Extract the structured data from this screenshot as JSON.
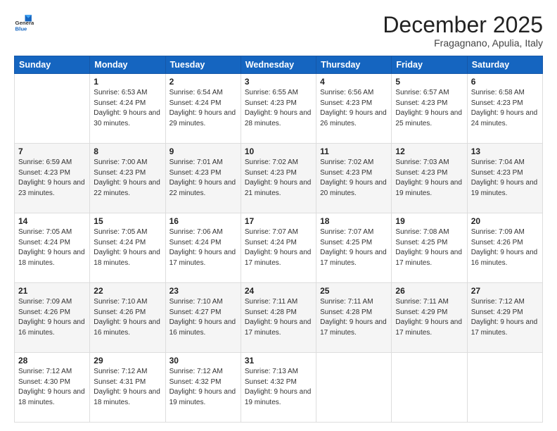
{
  "header": {
    "logo_general": "General",
    "logo_blue": "Blue",
    "month_title": "December 2025",
    "subtitle": "Fragagnano, Apulia, Italy"
  },
  "days_of_week": [
    "Sunday",
    "Monday",
    "Tuesday",
    "Wednesday",
    "Thursday",
    "Friday",
    "Saturday"
  ],
  "weeks": [
    [
      {
        "day": "",
        "sunrise": "",
        "sunset": "",
        "daylight": ""
      },
      {
        "day": "1",
        "sunrise": "Sunrise: 6:53 AM",
        "sunset": "Sunset: 4:24 PM",
        "daylight": "Daylight: 9 hours and 30 minutes."
      },
      {
        "day": "2",
        "sunrise": "Sunrise: 6:54 AM",
        "sunset": "Sunset: 4:24 PM",
        "daylight": "Daylight: 9 hours and 29 minutes."
      },
      {
        "day": "3",
        "sunrise": "Sunrise: 6:55 AM",
        "sunset": "Sunset: 4:23 PM",
        "daylight": "Daylight: 9 hours and 28 minutes."
      },
      {
        "day": "4",
        "sunrise": "Sunrise: 6:56 AM",
        "sunset": "Sunset: 4:23 PM",
        "daylight": "Daylight: 9 hours and 26 minutes."
      },
      {
        "day": "5",
        "sunrise": "Sunrise: 6:57 AM",
        "sunset": "Sunset: 4:23 PM",
        "daylight": "Daylight: 9 hours and 25 minutes."
      },
      {
        "day": "6",
        "sunrise": "Sunrise: 6:58 AM",
        "sunset": "Sunset: 4:23 PM",
        "daylight": "Daylight: 9 hours and 24 minutes."
      }
    ],
    [
      {
        "day": "7",
        "sunrise": "Sunrise: 6:59 AM",
        "sunset": "Sunset: 4:23 PM",
        "daylight": "Daylight: 9 hours and 23 minutes."
      },
      {
        "day": "8",
        "sunrise": "Sunrise: 7:00 AM",
        "sunset": "Sunset: 4:23 PM",
        "daylight": "Daylight: 9 hours and 22 minutes."
      },
      {
        "day": "9",
        "sunrise": "Sunrise: 7:01 AM",
        "sunset": "Sunset: 4:23 PM",
        "daylight": "Daylight: 9 hours and 22 minutes."
      },
      {
        "day": "10",
        "sunrise": "Sunrise: 7:02 AM",
        "sunset": "Sunset: 4:23 PM",
        "daylight": "Daylight: 9 hours and 21 minutes."
      },
      {
        "day": "11",
        "sunrise": "Sunrise: 7:02 AM",
        "sunset": "Sunset: 4:23 PM",
        "daylight": "Daylight: 9 hours and 20 minutes."
      },
      {
        "day": "12",
        "sunrise": "Sunrise: 7:03 AM",
        "sunset": "Sunset: 4:23 PM",
        "daylight": "Daylight: 9 hours and 19 minutes."
      },
      {
        "day": "13",
        "sunrise": "Sunrise: 7:04 AM",
        "sunset": "Sunset: 4:23 PM",
        "daylight": "Daylight: 9 hours and 19 minutes."
      }
    ],
    [
      {
        "day": "14",
        "sunrise": "Sunrise: 7:05 AM",
        "sunset": "Sunset: 4:24 PM",
        "daylight": "Daylight: 9 hours and 18 minutes."
      },
      {
        "day": "15",
        "sunrise": "Sunrise: 7:05 AM",
        "sunset": "Sunset: 4:24 PM",
        "daylight": "Daylight: 9 hours and 18 minutes."
      },
      {
        "day": "16",
        "sunrise": "Sunrise: 7:06 AM",
        "sunset": "Sunset: 4:24 PM",
        "daylight": "Daylight: 9 hours and 17 minutes."
      },
      {
        "day": "17",
        "sunrise": "Sunrise: 7:07 AM",
        "sunset": "Sunset: 4:24 PM",
        "daylight": "Daylight: 9 hours and 17 minutes."
      },
      {
        "day": "18",
        "sunrise": "Sunrise: 7:07 AM",
        "sunset": "Sunset: 4:25 PM",
        "daylight": "Daylight: 9 hours and 17 minutes."
      },
      {
        "day": "19",
        "sunrise": "Sunrise: 7:08 AM",
        "sunset": "Sunset: 4:25 PM",
        "daylight": "Daylight: 9 hours and 17 minutes."
      },
      {
        "day": "20",
        "sunrise": "Sunrise: 7:09 AM",
        "sunset": "Sunset: 4:26 PM",
        "daylight": "Daylight: 9 hours and 16 minutes."
      }
    ],
    [
      {
        "day": "21",
        "sunrise": "Sunrise: 7:09 AM",
        "sunset": "Sunset: 4:26 PM",
        "daylight": "Daylight: 9 hours and 16 minutes."
      },
      {
        "day": "22",
        "sunrise": "Sunrise: 7:10 AM",
        "sunset": "Sunset: 4:26 PM",
        "daylight": "Daylight: 9 hours and 16 minutes."
      },
      {
        "day": "23",
        "sunrise": "Sunrise: 7:10 AM",
        "sunset": "Sunset: 4:27 PM",
        "daylight": "Daylight: 9 hours and 16 minutes."
      },
      {
        "day": "24",
        "sunrise": "Sunrise: 7:11 AM",
        "sunset": "Sunset: 4:28 PM",
        "daylight": "Daylight: 9 hours and 17 minutes."
      },
      {
        "day": "25",
        "sunrise": "Sunrise: 7:11 AM",
        "sunset": "Sunset: 4:28 PM",
        "daylight": "Daylight: 9 hours and 17 minutes."
      },
      {
        "day": "26",
        "sunrise": "Sunrise: 7:11 AM",
        "sunset": "Sunset: 4:29 PM",
        "daylight": "Daylight: 9 hours and 17 minutes."
      },
      {
        "day": "27",
        "sunrise": "Sunrise: 7:12 AM",
        "sunset": "Sunset: 4:29 PM",
        "daylight": "Daylight: 9 hours and 17 minutes."
      }
    ],
    [
      {
        "day": "28",
        "sunrise": "Sunrise: 7:12 AM",
        "sunset": "Sunset: 4:30 PM",
        "daylight": "Daylight: 9 hours and 18 minutes."
      },
      {
        "day": "29",
        "sunrise": "Sunrise: 7:12 AM",
        "sunset": "Sunset: 4:31 PM",
        "daylight": "Daylight: 9 hours and 18 minutes."
      },
      {
        "day": "30",
        "sunrise": "Sunrise: 7:12 AM",
        "sunset": "Sunset: 4:32 PM",
        "daylight": "Daylight: 9 hours and 19 minutes."
      },
      {
        "day": "31",
        "sunrise": "Sunrise: 7:13 AM",
        "sunset": "Sunset: 4:32 PM",
        "daylight": "Daylight: 9 hours and 19 minutes."
      },
      {
        "day": "",
        "sunrise": "",
        "sunset": "",
        "daylight": ""
      },
      {
        "day": "",
        "sunrise": "",
        "sunset": "",
        "daylight": ""
      },
      {
        "day": "",
        "sunrise": "",
        "sunset": "",
        "daylight": ""
      }
    ]
  ]
}
